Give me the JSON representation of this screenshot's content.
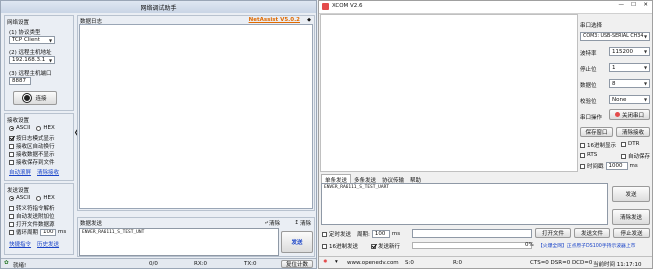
{
  "netassist": {
    "title": "网络调试助手",
    "brand": "NetAssist V5.0.2",
    "net_settings": {
      "heading": "网络设置",
      "protocol_label": "(1) 协议类型",
      "protocol_value": "TCP Client",
      "host_label": "(2) 远程主机地址",
      "host_value": "192.168.3.1",
      "port_label": "(3) 远程主机端口",
      "port_value": "8887",
      "connect_label": "连接"
    },
    "recv_settings": {
      "heading": "接收设置",
      "ascii": "ASCII",
      "hex": "HEX",
      "options": [
        "按日志模式显示",
        "接收区自动换行",
        "接收数据不显示",
        "接收保存到文件"
      ],
      "auto_scroll": "自动滚屏",
      "clear_recv": "清除接收"
    },
    "send_settings": {
      "heading": "发送设置",
      "ascii": "ASCII",
      "hex": "HEX",
      "options": [
        "转义符指令解析",
        "自动发送附加位",
        "打开文件数据源"
      ],
      "cycle_label": "循环周期",
      "cycle_value": "100",
      "cycle_unit": "ms",
      "quick_cmd": "快捷指令",
      "history": "历史发送"
    },
    "log_label": "数据日志",
    "send_label": "数据发送",
    "clear_label": "清除",
    "clear_all_label": "清除",
    "send_text": "ENVER_RA6111_S_TEST_UNT",
    "send_button": "发送",
    "status": {
      "ready": "就绪!",
      "counts": [
        "0/0",
        "RX:0",
        "TX:0"
      ],
      "reset": "复位计数"
    }
  },
  "xcom": {
    "title": "XCOM V2.6",
    "serial": {
      "port_label": "串口选择",
      "port_value": "COM3: USB-SERIAL CH34",
      "baud_label": "波特率",
      "baud_value": "115200",
      "stop_label": "停止位",
      "stop_value": "1",
      "data_label": "数据位",
      "data_value": "8",
      "parity_label": "校验位",
      "parity_value": "None",
      "op_label": "串口操作",
      "op_button": "关闭串口",
      "save_window": "保存窗口",
      "clear_recv": "清除接收",
      "hex_display": "16进制显示",
      "dtr": "DTR",
      "rts": "RTS",
      "auto_save": "自动保存",
      "timestamp": "时间戳",
      "timestamp_value": "1000",
      "timestamp_unit": "ms"
    },
    "tabs": [
      "单条发送",
      "多条发送",
      "协议传输",
      "帮助"
    ],
    "send_text": "ENVER_RA6111_S_TEST_UART",
    "send_button": "发送",
    "clear_send_button": "清除发送",
    "bottom": {
      "timed_send": "定时发送",
      "period_label": "周期:",
      "period_value": "100",
      "period_unit": "ms",
      "open_file": "打开文件",
      "send_file": "发送文件",
      "stop_send": "停止发送",
      "hex_send": "16进制发送",
      "newline": "发送新行",
      "progress_value": "0%",
      "promo": "【火爆全网】正点原子DS100手持示波器上市"
    },
    "status": {
      "website": "www.openedv.com",
      "s": "S:0",
      "r": "R:0",
      "signals": "CTS=0 DSR=0 DCD=0",
      "time": "当前时间 11:17:10"
    }
  },
  "colors": {
    "brand": "#e06a00",
    "link": "#1a44c8",
    "promo": "#1a44c8",
    "xcom_accent": "#e44b4b"
  }
}
